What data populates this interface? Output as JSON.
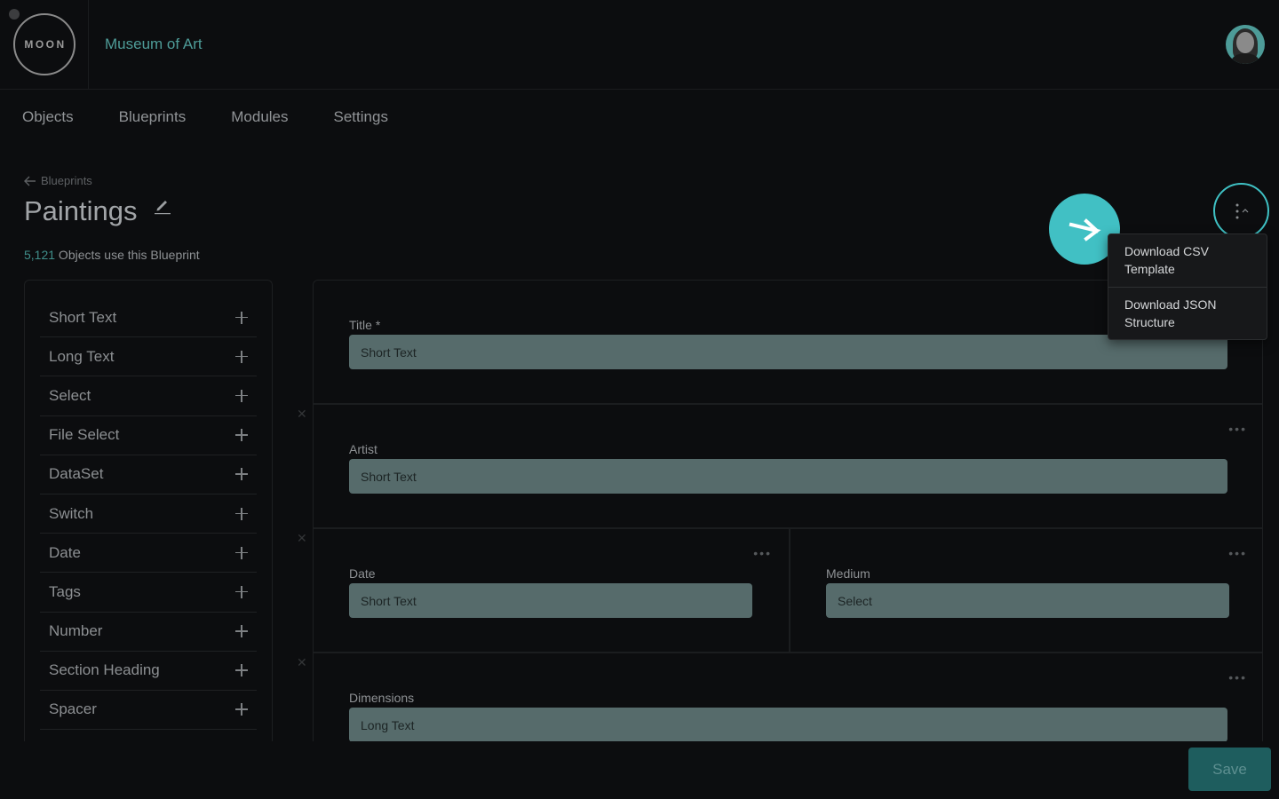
{
  "header": {
    "logo_text": "MOON",
    "org_name": "Museum of Art"
  },
  "nav": {
    "items": [
      {
        "label": "Objects"
      },
      {
        "label": "Blueprints"
      },
      {
        "label": "Modules"
      },
      {
        "label": "Settings"
      }
    ]
  },
  "page": {
    "back_label": "Blueprints",
    "title": "Paintings",
    "object_count": "5,121",
    "count_suffix": " Objects use this Blueprint"
  },
  "menu": {
    "items": [
      {
        "label": "Download CSV Template"
      },
      {
        "label": "Download JSON Structure"
      }
    ]
  },
  "sidebar": {
    "items": [
      {
        "label": "Short Text"
      },
      {
        "label": "Long Text"
      },
      {
        "label": "Select"
      },
      {
        "label": "File Select"
      },
      {
        "label": "DataSet"
      },
      {
        "label": "Switch"
      },
      {
        "label": "Date"
      },
      {
        "label": "Tags"
      },
      {
        "label": "Number"
      },
      {
        "label": "Section Heading"
      },
      {
        "label": "Spacer"
      }
    ]
  },
  "fields": {
    "title": {
      "label": "Title *",
      "type": "Short Text"
    },
    "artist": {
      "label": "Artist",
      "type": "Short Text"
    },
    "date": {
      "label": "Date",
      "type": "Short Text"
    },
    "medium": {
      "label": "Medium",
      "type": "Select"
    },
    "dimensions": {
      "label": "Dimensions",
      "type": "Long Text"
    }
  },
  "footer": {
    "save_label": "Save"
  },
  "colors": {
    "accent": "#41c0c4",
    "brand_text": "#4e9c98",
    "input_bg": "#566b6b",
    "save_bg": "#1e5d5e"
  }
}
